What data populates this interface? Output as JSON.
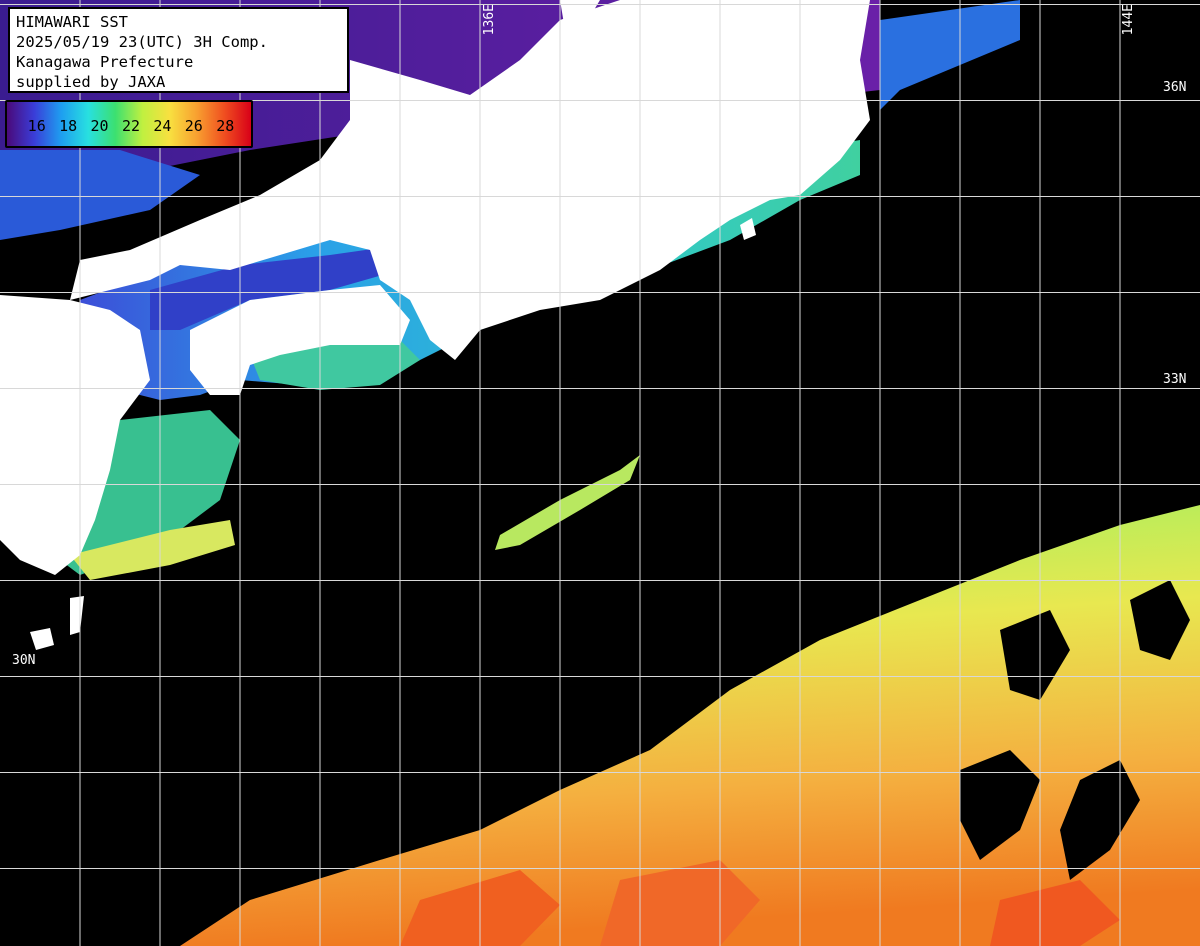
{
  "header": {
    "line1": "HIMAWARI SST",
    "line2": "2025/05/19 23(UTC) 3H Comp.",
    "line3": "Kanagawa Prefecture",
    "line4": "supplied by JAXA"
  },
  "legend": {
    "labels": [
      "16",
      "18",
      "20",
      "22",
      "24",
      "26",
      "28"
    ],
    "colors": [
      "#4a0a7a",
      "#3a3dd8",
      "#1e9ef0",
      "#28e0e0",
      "#3ce070",
      "#c0f040",
      "#f8e040",
      "#f8a030",
      "#f05020",
      "#d80018"
    ]
  },
  "grid_labels": {
    "lon_136": "136E",
    "lon_144": "144E",
    "lat_36": "36N",
    "lat_33": "33N",
    "lat_30": "30N"
  },
  "colors": {
    "land": "#ffffff",
    "cloud": "#000000",
    "grid": "#d8d8d8"
  }
}
